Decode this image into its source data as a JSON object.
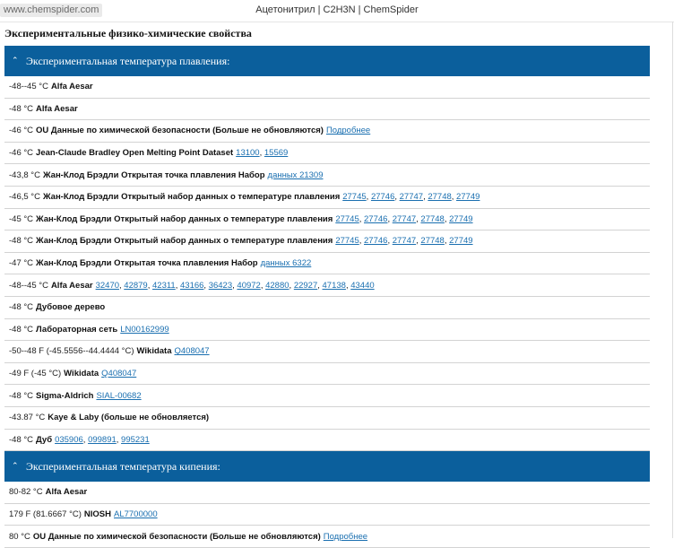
{
  "browser": {
    "url": "www.chemspider.com",
    "title": "Ацетонитрил | C2H3N | ChemSpider"
  },
  "page": {
    "section_title": "Экспериментальные физико-химические свойства"
  },
  "melting": {
    "header": "Экспериментальная температура плавления:",
    "rows": [
      {
        "value": "-48--45 °C",
        "source": "Alfa Aesar",
        "links": []
      },
      {
        "value": "-48 °C",
        "source": "Alfa Aesar",
        "links": []
      },
      {
        "value": "-46 °C",
        "source": "OU Данные по химической безопасности (Больше не обновляются)",
        "more": "Подробнее",
        "links": []
      },
      {
        "value": "-46 °C",
        "source": "Jean-Claude Bradley Open Melting Point Dataset",
        "links": [
          "13100",
          "15569"
        ]
      },
      {
        "value": "-43,8 °C",
        "source": "Жан-Клод Брэдли Открытая точка плавления Набор",
        "more": "данных 21309",
        "links": []
      },
      {
        "value": "-46,5 °C",
        "source": "Жан-Клод Брэдли Открытый набор данных о температуре плавления",
        "links": [
          "27745",
          "27746",
          "27747",
          "27748",
          "27749"
        ]
      },
      {
        "value": "-45 °C",
        "source": "Жан-Клод Брэдли Открытый набор данных о температуре плавления",
        "links": [
          "27745",
          "27746",
          "27747",
          "27748",
          "27749"
        ]
      },
      {
        "value": "-48 °C",
        "source": "Жан-Клод Брэдли Открытый набор данных о температуре плавления",
        "links": [
          "27745",
          "27746",
          "27747",
          "27748",
          "27749"
        ]
      },
      {
        "value": "-47 °C",
        "source": "Жан-Клод Брэдли Открытая точка плавления Набор",
        "more": "данных 6322",
        "links": []
      },
      {
        "value": "-48--45 °C",
        "source": "Alfa Aesar",
        "links": [
          "32470",
          "42879",
          "42311",
          "43166",
          "36423",
          "40972",
          "42880",
          "22927",
          "47138",
          "43440"
        ]
      },
      {
        "value": "-48 °C",
        "source": "Дубовое дерево",
        "links": []
      },
      {
        "value": "-48 °C",
        "source": "Лабораторная сеть",
        "links": [
          "LN00162999"
        ]
      },
      {
        "value": "-50--48 F (-45.5556--44.4444 °C)",
        "source": "Wikidata",
        "links": [
          "Q408047"
        ]
      },
      {
        "value": "-49 F (-45 °C)",
        "source": "Wikidata",
        "links": [
          "Q408047"
        ]
      },
      {
        "value": "-48 °C",
        "source": "Sigma-Aldrich",
        "links": [
          "SIAL-00682"
        ]
      },
      {
        "value": "-43.87 °C",
        "source": "Kaye & Laby (больше не обновляется)",
        "links": []
      },
      {
        "value": "-48 °C",
        "source": "Дуб",
        "links": [
          "035906",
          "099891",
          "995231"
        ]
      }
    ]
  },
  "boiling": {
    "header": "Экспериментальная температура кипения:",
    "rows": [
      {
        "value": "80-82 °C",
        "source": "Alfa Aesar",
        "links": []
      },
      {
        "value": "179 F (81.6667 °C)",
        "source": "NIOSH",
        "links": [
          "AL7700000"
        ]
      },
      {
        "value": "80 °C",
        "source": "OU Данные по химической безопасности (Больше не обновляются)",
        "more": "Подробнее",
        "links": []
      }
    ]
  }
}
